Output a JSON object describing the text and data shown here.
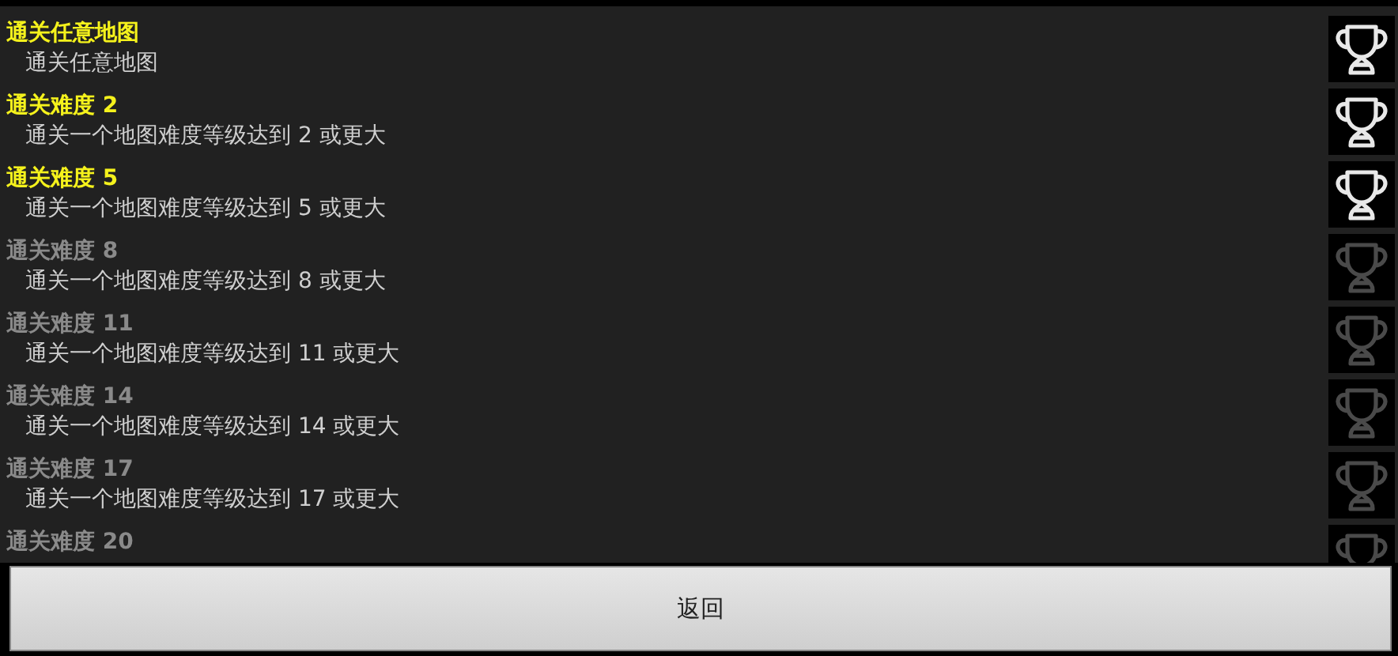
{
  "achievements": [
    {
      "title": "通关任意地图",
      "description": "通关任意地图",
      "unlocked": true
    },
    {
      "title": "通关难度 2",
      "description": "通关一个地图难度等级达到 2 或更大",
      "unlocked": true
    },
    {
      "title": "通关难度 5",
      "description": "通关一个地图难度等级达到 5 或更大",
      "unlocked": true
    },
    {
      "title": "通关难度 8",
      "description": "通关一个地图难度等级达到 8 或更大",
      "unlocked": false
    },
    {
      "title": "通关难度 11",
      "description": "通关一个地图难度等级达到 11 或更大",
      "unlocked": false
    },
    {
      "title": "通关难度 14",
      "description": "通关一个地图难度等级达到 14 或更大",
      "unlocked": false
    },
    {
      "title": "通关难度 17",
      "description": "通关一个地图难度等级达到 17 或更大",
      "unlocked": false
    },
    {
      "title": "通关难度 20",
      "unlocked": false
    }
  ],
  "back_button": "返回"
}
